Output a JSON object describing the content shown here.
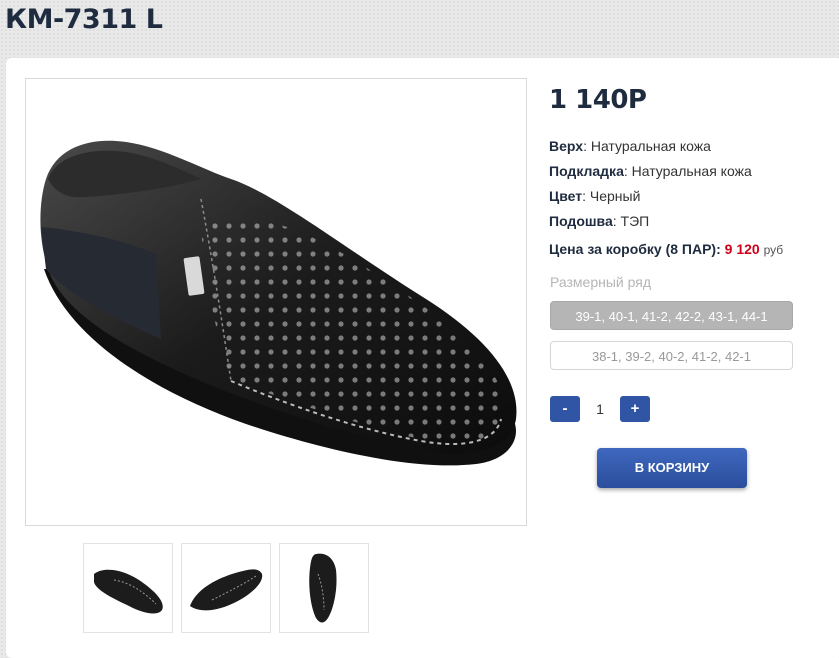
{
  "product": {
    "title": "КМ-7311 L",
    "price": "1 140Р",
    "specs": [
      {
        "label": "Верх",
        "value": ": Натуральная кожа"
      },
      {
        "label": "Подкладка",
        "value": ": Натуральная кожа"
      },
      {
        "label": "Цвет",
        "value": ": Черный"
      },
      {
        "label": "Подошва",
        "value": ": ТЭП"
      }
    ],
    "box_price": {
      "label": "Цена за коробку (8 ПАР): ",
      "value": "9 120",
      "currency": "руб"
    }
  },
  "sizes": {
    "label": "Размерный ряд",
    "options": [
      "39-1, 40-1, 41-2, 42-2, 43-1, 44-1",
      "38-1, 39-2, 40-2, 41-2, 42-1"
    ],
    "selected": 0
  },
  "quantity": {
    "minus": "-",
    "value": "1",
    "plus": "+"
  },
  "cart_button": "В КОРЗИНУ",
  "images": {
    "main": "black-perforated-leather-loafer",
    "thumbnails": [
      "loafer-top-view",
      "loafer-side-view",
      "loafer-front-view"
    ]
  },
  "colors": {
    "accent": "#2f55a4",
    "price_highlight": "#d0021b",
    "title": "#1f2b3f"
  }
}
